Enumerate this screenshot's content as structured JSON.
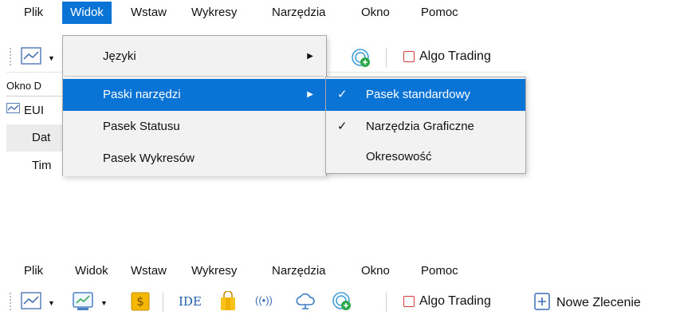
{
  "top": {
    "menu": [
      "Plik",
      "Widok",
      "Wstaw",
      "Wykresy",
      "Narzędzia",
      "Okno",
      "Pomoc"
    ],
    "toolbar": {
      "algo_trading": "Algo Trading"
    },
    "side_panel": {
      "title": "Okno D",
      "rows": [
        "EUI",
        "Dat",
        "Tim"
      ]
    },
    "view_menu": {
      "items": [
        "Języki",
        "Paski narzędzi",
        "Pasek Statusu",
        "Pasek Wykresów"
      ]
    },
    "toolbars_submenu": {
      "items": [
        "Pasek standardowy",
        "Narzędzia Graficzne",
        "Okresowość"
      ],
      "checked": [
        true,
        true,
        false
      ]
    }
  },
  "bottom": {
    "menu": [
      "Plik",
      "Widok",
      "Wstaw",
      "Wykresy",
      "Narzędzia",
      "Okno",
      "Pomoc"
    ],
    "toolbar": {
      "ide": "IDE",
      "algo_trading": "Algo Trading",
      "new_order": "Nowe Zlecenie"
    }
  },
  "colors": {
    "highlight": "#0a73d6",
    "algo_red": "#d63a3a",
    "dollar_gold": "#f5b800",
    "radar_green": "#2aa84a"
  },
  "icons": [
    "chart-line-icon",
    "dropdown-arrow-icon",
    "chart-templates-icon",
    "dollar-icon",
    "shopping-bag-icon",
    "signal-icon",
    "cloud-icon",
    "radar-add-icon",
    "stop-checkbox-icon",
    "plus-order-icon",
    "submenu-arrow-icon",
    "checkmark-icon"
  ]
}
